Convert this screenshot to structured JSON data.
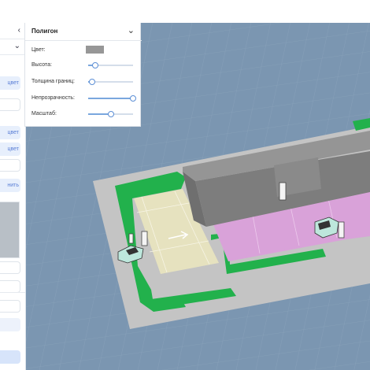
{
  "panel": {
    "title": "Полигон",
    "color_label": "Цвет:",
    "color_value": "#979797",
    "sliders": [
      {
        "label": "Высота:",
        "value": 0.15
      },
      {
        "label": "Толщина границ:",
        "value": 0.08
      },
      {
        "label": "Непрозрачность:",
        "value": 1.0
      },
      {
        "label": "Масштаб:",
        "value": 0.5
      }
    ]
  },
  "left_panel": {
    "btn1": "цвет",
    "btn2": "цвет",
    "btn3": "цвет",
    "btn4": "нить"
  },
  "scene": {
    "background": "#7a95b0",
    "ground": "#c3c3c3",
    "grass": "#22b14c",
    "parking_beige": "#e6e2bf",
    "parking_pink": "#d9a2d9",
    "building": "#8f8f8f"
  }
}
